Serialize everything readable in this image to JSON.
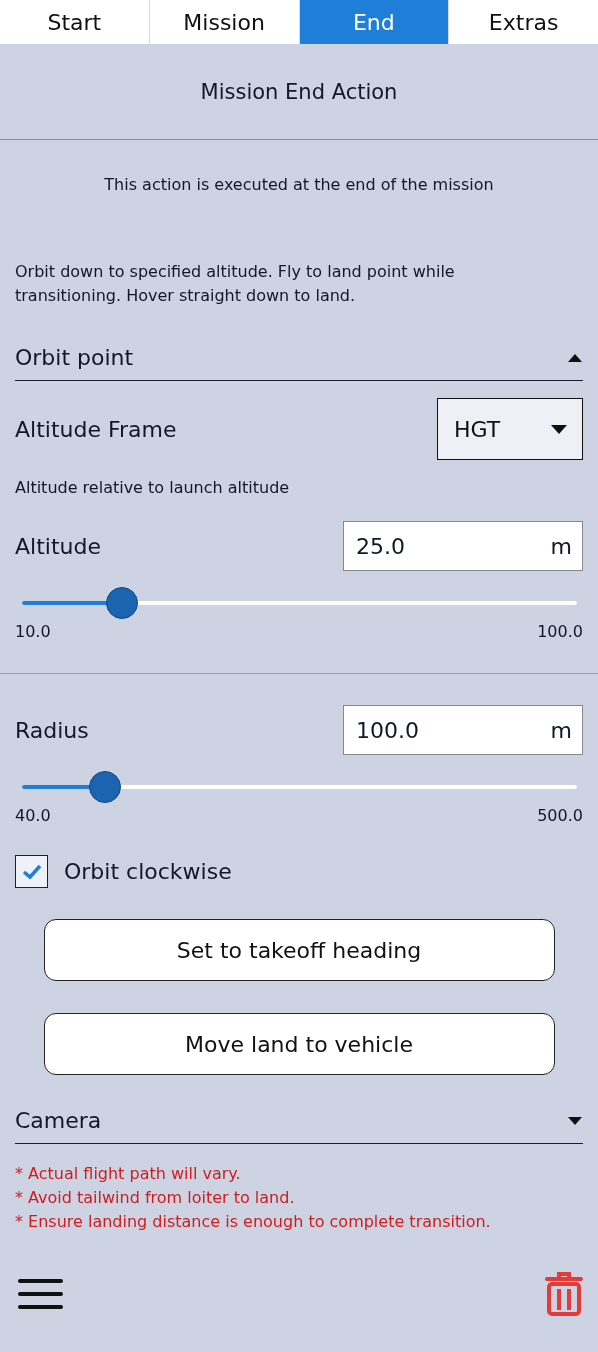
{
  "tabs": [
    {
      "label": "Start",
      "selected": false
    },
    {
      "label": "Mission",
      "selected": false
    },
    {
      "label": "End",
      "selected": true
    },
    {
      "label": "Extras",
      "selected": false
    }
  ],
  "title": "Mission End Action",
  "subtitle": "This action is executed at the end of the mission",
  "description": "Orbit down to specified altitude. Fly to land point while transitioning. Hover straight down to land.",
  "orbit_section": {
    "title": "Orbit point",
    "expanded": true
  },
  "altitude_frame": {
    "label": "Altitude Frame",
    "value": "HGT",
    "hint": "Altitude relative to launch altitude"
  },
  "sliders": [
    {
      "label": "Altitude",
      "value": "25.0",
      "unit": "m",
      "min": "10.0",
      "max": "100.0",
      "level": 0.18
    },
    {
      "label": "Radius",
      "value": "100.0",
      "unit": "m",
      "min": "40.0",
      "max": "500.0",
      "level": 0.15
    }
  ],
  "orbit_clockwise": {
    "label": "Orbit clockwise",
    "checked": true
  },
  "buttons": [
    "Set to takeoff heading",
    "Move land to vehicle"
  ],
  "camera_section": {
    "title": "Camera",
    "expanded": false
  },
  "notes": [
    "* Actual flight path will vary.",
    "* Avoid tailwind from loiter to land.",
    "* Ensure landing distance is enough to complete transition."
  ]
}
